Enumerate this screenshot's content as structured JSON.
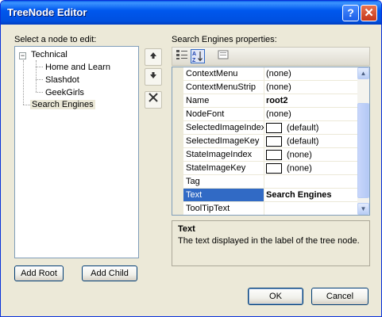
{
  "window": {
    "title": "TreeNode Editor",
    "help_glyph": "?",
    "close_glyph": "✕"
  },
  "left": {
    "label": "Select a node to edit:",
    "tree": {
      "root": "Technical",
      "expander": "−",
      "children": [
        "Home and Learn",
        "Slashdot",
        "GeekGirls"
      ],
      "sibling": "Search Engines"
    },
    "add_root": "Add Root",
    "add_child": "Add Child"
  },
  "middle_buttons": {
    "up_icon": "arrow-up-icon",
    "down_icon": "arrow-down-icon",
    "delete_icon": "delete-x-icon"
  },
  "properties": {
    "label": "Search Engines properties:",
    "rows": [
      {
        "name": "ContextMenu",
        "value": "(none)"
      },
      {
        "name": "ContextMenuStrip",
        "value": "(none)"
      },
      {
        "name": "Name",
        "value": "root2"
      },
      {
        "name": "NodeFont",
        "value": "(none)"
      },
      {
        "name": "SelectedImageIndex",
        "value": "(default)"
      },
      {
        "name": "SelectedImageKey",
        "value": "(default)"
      },
      {
        "name": "StateImageIndex",
        "value": "(none)"
      },
      {
        "name": "StateImageKey",
        "value": "(none)"
      },
      {
        "name": "Tag",
        "value": ""
      },
      {
        "name": "Text",
        "value": "Search Engines"
      },
      {
        "name": "ToolTipText",
        "value": ""
      }
    ],
    "description": {
      "title": "Text",
      "text": "The text displayed in the label of the tree node."
    }
  },
  "footer": {
    "ok": "OK",
    "cancel": "Cancel"
  },
  "colors": {
    "title_blue": "#0058ee",
    "selection": "#316ac5",
    "face": "#ece9d8"
  }
}
